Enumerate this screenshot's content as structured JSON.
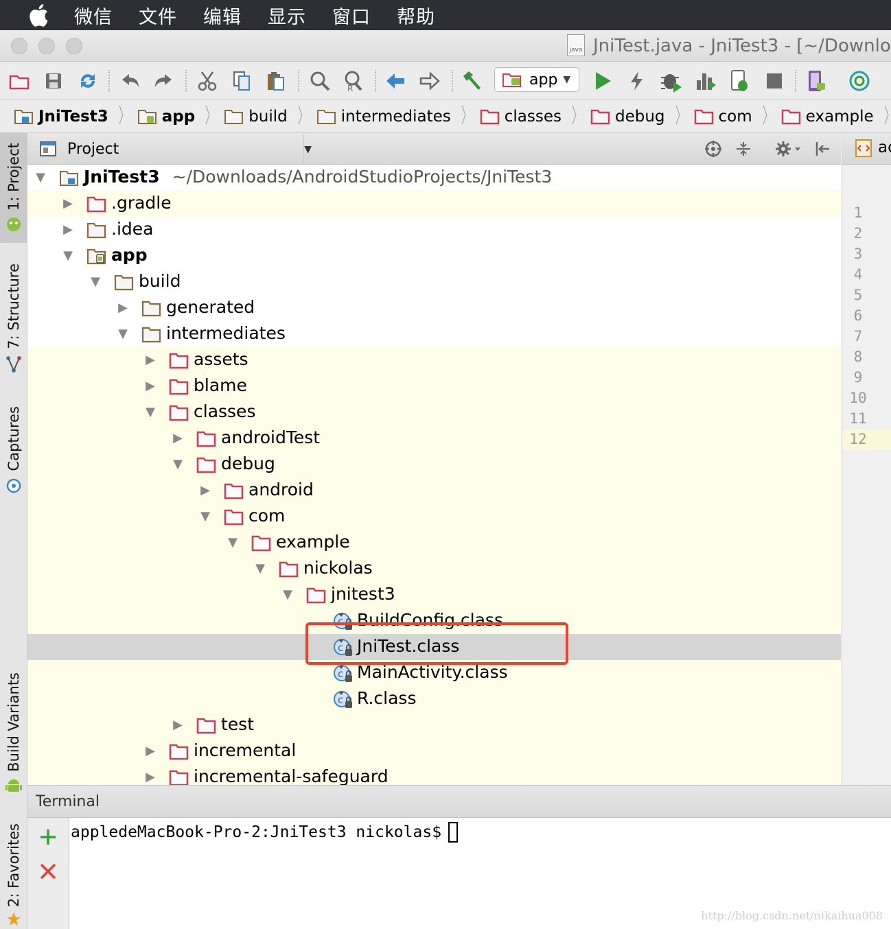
{
  "menubar": {
    "items": [
      "微信",
      "文件",
      "编辑",
      "显示",
      "窗口",
      "帮助"
    ]
  },
  "window": {
    "title": "JniTest.java - JniTest3 - [~/Downloa",
    "file_badge": "java"
  },
  "toolbar": {
    "run_config": "app"
  },
  "breadcrumbs": [
    "JniTest3",
    "app",
    "build",
    "intermediates",
    "classes",
    "debug",
    "com",
    "example",
    "nickolas"
  ],
  "left_tabs": {
    "project": "1: Project",
    "structure": "7: Structure",
    "captures": "Captures",
    "build_variants": "Build Variants",
    "favorites": "2: Favorites"
  },
  "project_panel": {
    "view_mode": "Project"
  },
  "tree": {
    "root": {
      "name": "JniTest3",
      "path": "~/Downloads/AndroidStudioProjects/JniTest3"
    },
    "gradle": ".gradle",
    "idea": ".idea",
    "app": "app",
    "build": "build",
    "generated": "generated",
    "intermediates": "intermediates",
    "assets": "assets",
    "blame": "blame",
    "classes": "classes",
    "androidTest": "androidTest",
    "debug": "debug",
    "android": "android",
    "com": "com",
    "example": "example",
    "nickolas": "nickolas",
    "jnitest3": "jnitest3",
    "buildconfig": "BuildConfig.class",
    "jnitest": "JniTest.class",
    "mainactivity": "MainActivity.class",
    "r": "R.class",
    "test": "test",
    "incremental": "incremental",
    "incremental_safeguard": "incremental-safeguard"
  },
  "editor": {
    "tab_label": "ac",
    "line_numbers": [
      "1",
      "2",
      "3",
      "4",
      "5",
      "6",
      "7",
      "8",
      "9",
      "10",
      "11",
      "12"
    ]
  },
  "terminal": {
    "title": "Terminal",
    "prompt": "appledeMacBook-Pro-2:JniTest3 nickolas$"
  },
  "watermark": "http://blog.csdn.net/nikaihua008",
  "colors": {
    "menubar": "#2d2f34",
    "tree_highlight": "#fdfde8",
    "selection": "#d5d5d5",
    "annotation": "#f0412a",
    "folder": "#c9405a"
  }
}
